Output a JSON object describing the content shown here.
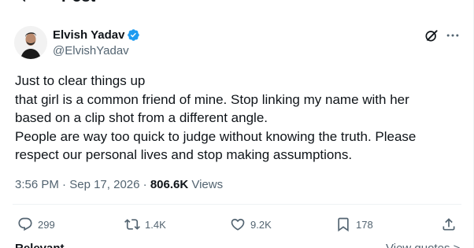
{
  "header": {
    "title": "Post"
  },
  "author": {
    "name": "Elvish Yadav",
    "handle": "@ElvishYadav"
  },
  "tweet": {
    "lines": [
      "Just to clear things up",
      "that girl is a common friend of mine. Stop linking my name with her",
      "based on a clip shot from a different angle.",
      "People are way too quick to judge without knowing the truth. Please",
      "respect our personal lives and stop making assumptions."
    ],
    "time": "3:56 PM",
    "date": "Sep 17, 2026",
    "views_count": "806.6K",
    "views_label": "Views"
  },
  "actions": {
    "replies": "299",
    "reposts": "1.4K",
    "likes": "9.2K",
    "bookmarks": "178"
  },
  "bottom": {
    "relevant": "Relevant",
    "view_quotes": "View quotes >"
  },
  "colors": {
    "verified": "#1d9bf0",
    "secondary_text": "#536471",
    "primary_text": "#0f1419",
    "divider": "#eff3f4"
  }
}
